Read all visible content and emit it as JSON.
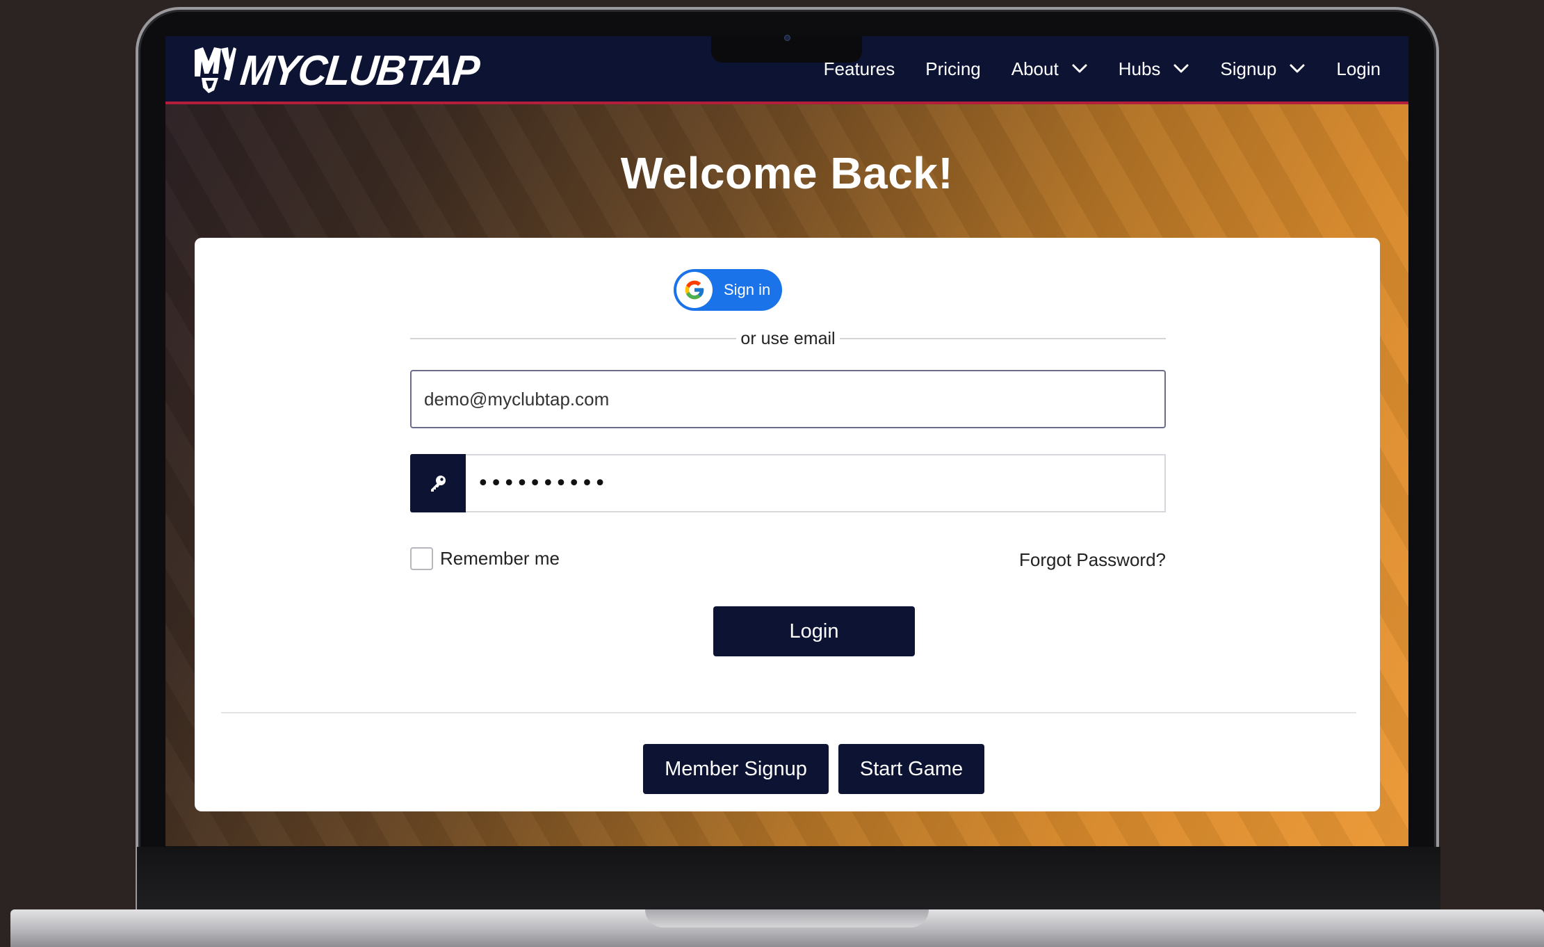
{
  "brand": {
    "logo_text": "MYCLUBTAP",
    "logo_mark": "MY"
  },
  "nav": {
    "items": [
      {
        "label": "Features",
        "dropdown": false
      },
      {
        "label": "Pricing",
        "dropdown": false
      },
      {
        "label": "About",
        "dropdown": true
      },
      {
        "label": "Hubs",
        "dropdown": true
      },
      {
        "label": "Signup",
        "dropdown": true
      },
      {
        "label": "Login",
        "dropdown": false
      }
    ]
  },
  "page": {
    "title": "Welcome Back!"
  },
  "login_form": {
    "google_button_label": "Sign in",
    "divider_text": "or use email",
    "email_value": "demo@myclubtap.com",
    "password_value": "••••••••••",
    "remember_label": "Remember me",
    "forgot_label": "Forgot Password?",
    "submit_label": "Login"
  },
  "footer_actions": {
    "member_signup_label": "Member Signup",
    "start_game_label": "Start Game"
  },
  "colors": {
    "navy": "#0c1333",
    "accent_red": "#b31e3a",
    "google_blue": "#1a73e8",
    "orange": "#ec9936"
  },
  "icons": [
    "chevron-down-icon",
    "key-icon",
    "google-icon",
    "myclubtap-logo-icon"
  ]
}
